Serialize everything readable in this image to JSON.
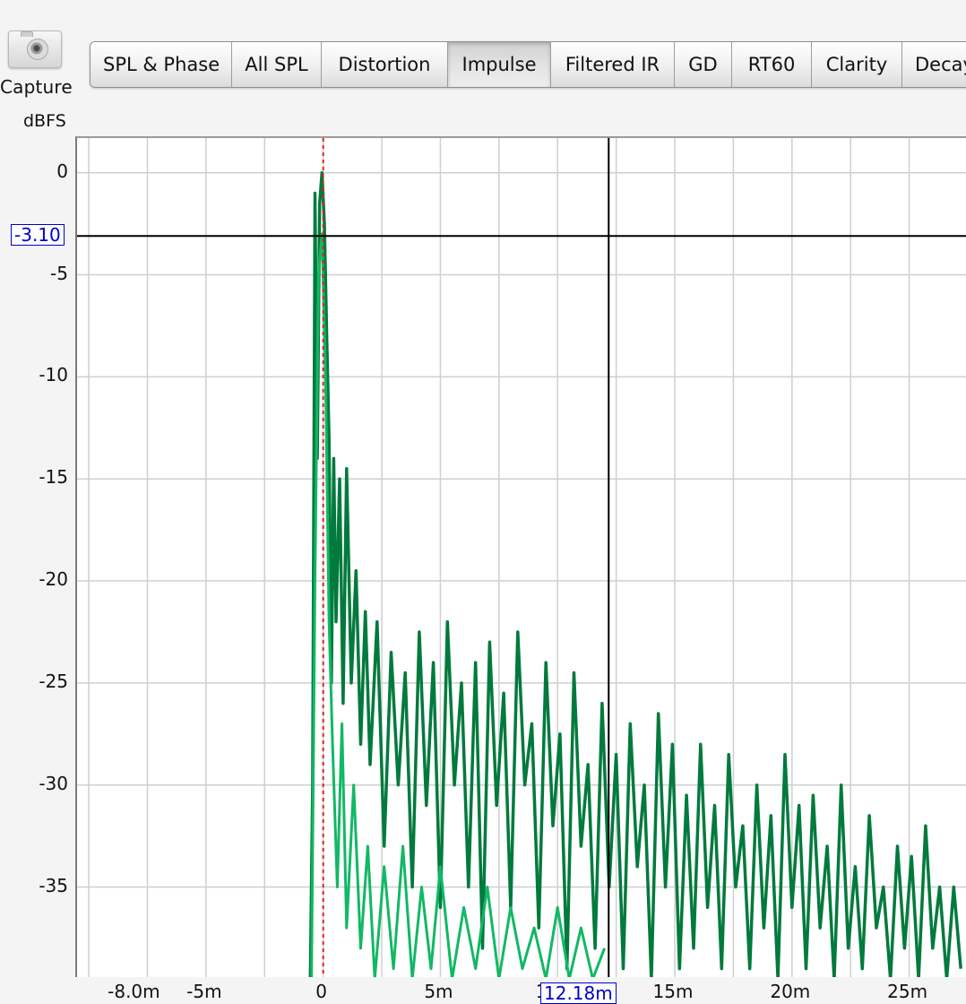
{
  "capture": {
    "label": "Capture"
  },
  "tabs": [
    {
      "label": "SPL & Phase"
    },
    {
      "label": "All SPL"
    },
    {
      "label": "Distortion"
    },
    {
      "label": "Impulse",
      "active": true
    },
    {
      "label": "Filtered IR"
    },
    {
      "label": "GD"
    },
    {
      "label": "RT60"
    },
    {
      "label": "Clarity"
    },
    {
      "label": "Decay"
    }
  ],
  "plot": {
    "ylabel": "dBFS",
    "cursor": {
      "y_readout": "-3.10",
      "x_readout": "12.18m",
      "x": 12.18,
      "y": -3.1
    },
    "reference_marker_x": 0
  },
  "chart_data": {
    "type": "line",
    "xlim": [
      -10.5,
      27.5
    ],
    "ylim": [
      -39.5,
      1.7
    ],
    "yticks": [
      "0",
      "-5",
      "-10",
      "-15",
      "-20",
      "-25",
      "-30",
      "-35"
    ],
    "ytick_values": [
      0,
      -5,
      -10,
      -15,
      -20,
      -25,
      -30,
      -35
    ],
    "xticks": [
      "-8.0m",
      "-5m",
      "0",
      "5m",
      "10m",
      "15m",
      "20m",
      "25m"
    ],
    "xtick_values": [
      -8,
      -5,
      0,
      5,
      10,
      15,
      20,
      25
    ],
    "grid": true,
    "colors": {
      "trace_dark": "#007a3d",
      "trace_light": "#12b865",
      "marker": "#e02020",
      "cursor": "#000000"
    },
    "series": [
      {
        "style": "dark",
        "x": [
          -0.55,
          -0.45,
          -0.35,
          -0.25,
          -0.15,
          -0.05,
          0.05,
          0.15,
          0.25,
          0.35,
          0.45,
          0.55,
          0.7,
          0.85,
          1.0,
          1.2,
          1.4,
          1.6,
          1.8,
          2.0,
          2.3,
          2.6,
          2.9,
          3.2,
          3.5,
          3.8,
          4.1,
          4.4,
          4.7,
          5.0,
          5.3,
          5.6,
          5.9,
          6.2,
          6.5,
          6.8,
          7.1,
          7.4,
          7.7,
          8.0,
          8.3,
          8.6,
          8.9,
          9.2,
          9.5,
          9.8,
          10.1,
          10.4,
          10.7,
          11.0,
          11.3,
          11.6,
          11.9,
          12.2,
          12.5,
          12.8,
          13.1,
          13.4,
          13.7,
          14.0,
          14.3,
          14.6,
          14.9,
          15.2,
          15.5,
          15.8,
          16.1,
          16.4,
          16.7,
          17.0,
          17.3,
          17.6,
          17.9,
          18.2,
          18.5,
          18.8,
          19.1,
          19.4,
          19.7,
          20.0,
          20.3,
          20.6,
          20.9,
          21.2,
          21.5,
          21.8,
          22.1,
          22.4,
          22.7,
          23.0,
          23.3,
          23.6,
          23.9,
          24.2,
          24.5,
          24.8,
          25.1,
          25.4,
          25.7,
          26.0,
          26.3,
          26.6,
          26.9,
          27.2
        ],
        "y": [
          -39.5,
          -30,
          -1.0,
          -14,
          -1.5,
          0,
          -2.5,
          -8,
          -13,
          -25,
          -14,
          -22,
          -15,
          -26,
          -14.5,
          -25,
          -19.5,
          -28,
          -21.5,
          -29,
          -22,
          -33,
          -23.5,
          -30,
          -24.5,
          -35,
          -22.5,
          -31,
          -24,
          -36,
          -22,
          -30,
          -25,
          -35,
          -24,
          -38,
          -23,
          -31,
          -25.5,
          -36,
          -22.5,
          -30,
          -27,
          -37,
          -24,
          -32,
          -27.5,
          -39,
          -24.5,
          -33,
          -29,
          -38,
          -26,
          -35,
          -28.5,
          -39,
          -27,
          -34,
          -30,
          -39.5,
          -26.5,
          -35,
          -28,
          -39,
          -30.5,
          -38,
          -28,
          -36,
          -31,
          -39,
          -28.5,
          -35,
          -32,
          -39,
          -30,
          -37,
          -31.5,
          -39.5,
          -28.5,
          -36,
          -31,
          -39,
          -30.5,
          -37,
          -33,
          -39.5,
          -30,
          -38,
          -34,
          -39,
          -31.5,
          -37,
          -35,
          -39.5,
          -33,
          -38,
          -33.5,
          -39.5,
          -32,
          -38,
          -35,
          -39.5,
          -35,
          -39
        ]
      },
      {
        "style": "light",
        "x": [
          -0.5,
          -0.35,
          -0.2,
          -0.05,
          0.1,
          0.25,
          0.4,
          0.6,
          0.8,
          1.0,
          1.3,
          1.6,
          1.9,
          2.2,
          2.6,
          3.0,
          3.4,
          3.8,
          4.2,
          4.6,
          5.0,
          5.5,
          6.0,
          6.5,
          7.0,
          7.5,
          8.0,
          8.5,
          9.0,
          9.5,
          10.0,
          10.5,
          11.0,
          11.5,
          12.0
        ],
        "y": [
          -39.5,
          -20,
          -5,
          -3,
          -10,
          -22,
          -28,
          -35,
          -27,
          -37,
          -30,
          -38,
          -33,
          -39.5,
          -34,
          -39,
          -33,
          -39.5,
          -35,
          -39,
          -34,
          -39.5,
          -36,
          -39,
          -35,
          -39.5,
          -36,
          -39,
          -37,
          -39.5,
          -36,
          -39.5,
          -37,
          -39.5,
          -38
        ]
      }
    ]
  }
}
